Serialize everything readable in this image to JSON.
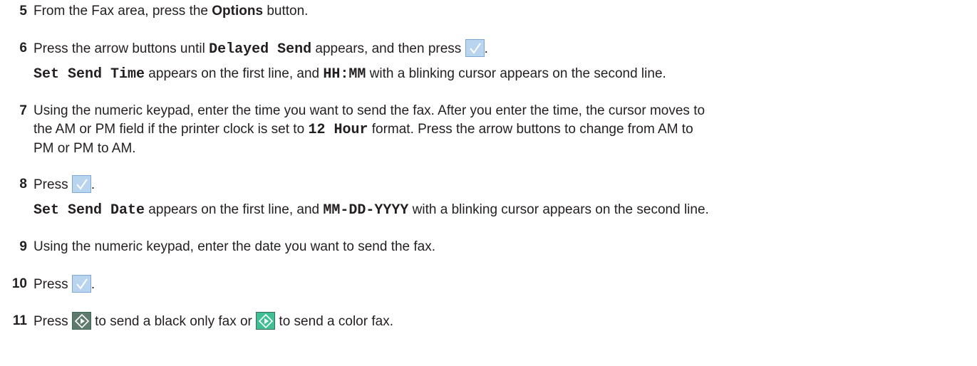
{
  "steps": [
    {
      "num": "5",
      "parts": {
        "a": "From the Fax area, press the ",
        "b": "Options",
        "c": " button."
      }
    },
    {
      "num": "6",
      "parts": {
        "a": "Press the arrow buttons until ",
        "b": "Delayed Send",
        "c": " appears, and then press ",
        "d": "."
      },
      "sub": {
        "a": "Set Send Time",
        "b": " appears on the first line, and ",
        "c": "HH:MM",
        "d": " with a blinking cursor appears on the second line."
      }
    },
    {
      "num": "7",
      "lines": [
        "Using the numeric keypad, enter the time you want to send the fax. After you enter the time, the cursor moves to",
        "the AM or PM field if the printer clock is set to ",
        "12 Hour",
        " format. Press the arrow buttons to change from AM to",
        "PM or PM to AM."
      ]
    },
    {
      "num": "8",
      "parts": {
        "a": "Press ",
        "b": "."
      },
      "sub": {
        "a": "Set Send Date",
        "b": " appears on the first line, and ",
        "c": "MM-DD-YYYY",
        "d": " with a blinking cursor appears on the second line."
      }
    },
    {
      "num": "9",
      "parts": {
        "a": "Using the numeric keypad, enter the date you want to send the fax."
      }
    },
    {
      "num": "10",
      "parts": {
        "a": "Press ",
        "b": "."
      }
    },
    {
      "num": "11",
      "parts": {
        "a": "Press ",
        "b": " to send a black only fax or ",
        "c": " to send a color fax."
      }
    }
  ],
  "icons": {
    "check": "checkmark-button-icon",
    "start_black": "start-black-button-icon",
    "start_color": "start-color-button-icon"
  },
  "colors": {
    "check_bg": "#b9d4ef",
    "start_black": "#5e7a6e",
    "start_color": "#3fbf93"
  }
}
